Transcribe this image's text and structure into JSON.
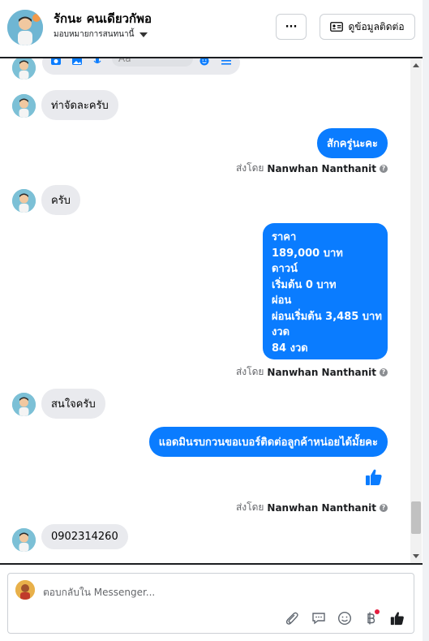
{
  "header": {
    "contact_name": "รักนะ คนเดียวกัพอ",
    "assign_label": "มอบหมายการสนทนานี้",
    "more_label": "···",
    "contact_info_label": "ดูข้อมูลติดต่อ"
  },
  "preview": {
    "placeholder": "Aa"
  },
  "messages": [
    {
      "dir": "in",
      "text": "ท่าจัดละครับ"
    },
    {
      "dir": "out",
      "text": "สักครู่นะคะ"
    },
    {
      "dir": "in",
      "text": "ครับ"
    },
    {
      "dir": "out",
      "lines": [
        "ราคา",
        "189,000 บาท",
        "ดาวน์",
        "เริ่มต้น 0 บาท",
        "ผ่อน",
        "ผ่อนเริ่มต้น 3,485 บาท",
        "งวด",
        "84 งวด"
      ]
    },
    {
      "dir": "in",
      "text": "สนใจครับ"
    },
    {
      "dir": "out",
      "text": "แอดมินรบกวนขอเบอร์ติดต่อลูกค้าหน่อยได้มั้ยคะ"
    },
    {
      "dir": "in",
      "text": "0902314260"
    }
  ],
  "sent_by": {
    "prefix": "ส่งโดย",
    "name": "Nanwhan Nanthanit",
    "help": "?"
  },
  "composer": {
    "placeholder": "ตอบกลับใน Messenger..."
  },
  "colors": {
    "accent": "#0a7cff",
    "incoming_bubble": "#e9eaee"
  }
}
